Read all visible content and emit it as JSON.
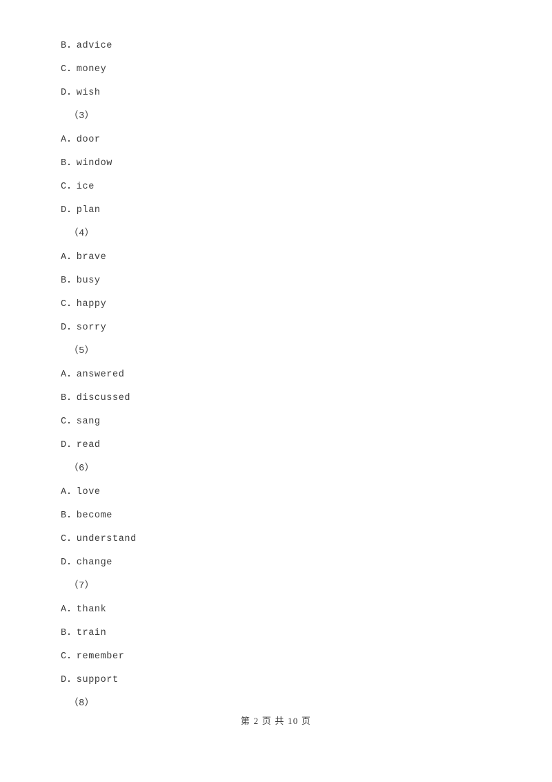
{
  "document": {
    "kind": "exam-worksheet-page",
    "lines": [
      {
        "type": "option",
        "text": "B．advice"
      },
      {
        "type": "option",
        "text": "C．money"
      },
      {
        "type": "option",
        "text": "D．wish"
      },
      {
        "type": "qnum",
        "text": "（3）"
      },
      {
        "type": "option",
        "text": "A．door"
      },
      {
        "type": "option",
        "text": "B．window"
      },
      {
        "type": "option",
        "text": "C．ice"
      },
      {
        "type": "option",
        "text": "D．plan"
      },
      {
        "type": "qnum",
        "text": "（4）"
      },
      {
        "type": "option",
        "text": "A．brave"
      },
      {
        "type": "option",
        "text": "B．busy"
      },
      {
        "type": "option",
        "text": "C．happy"
      },
      {
        "type": "option",
        "text": "D．sorry"
      },
      {
        "type": "qnum",
        "text": "（5）"
      },
      {
        "type": "option",
        "text": "A．answered"
      },
      {
        "type": "option",
        "text": "B．discussed"
      },
      {
        "type": "option",
        "text": "C．sang"
      },
      {
        "type": "option",
        "text": "D．read"
      },
      {
        "type": "qnum",
        "text": "（6）"
      },
      {
        "type": "option",
        "text": "A．love"
      },
      {
        "type": "option",
        "text": "B．become"
      },
      {
        "type": "option",
        "text": "C．understand"
      },
      {
        "type": "option",
        "text": "D．change"
      },
      {
        "type": "qnum",
        "text": "（7）"
      },
      {
        "type": "option",
        "text": "A．thank"
      },
      {
        "type": "option",
        "text": "B．train"
      },
      {
        "type": "option",
        "text": "C．remember"
      },
      {
        "type": "option",
        "text": "D．support"
      },
      {
        "type": "qnum",
        "text": "（8）"
      }
    ]
  },
  "footer": {
    "page_label": "第 2 页 共 10 页",
    "current_page": 2,
    "total_pages": 10
  },
  "colors": {
    "page_background": "#ffffff",
    "body_text": "#3a3a3a",
    "footer_text": "#3f3f3f"
  }
}
